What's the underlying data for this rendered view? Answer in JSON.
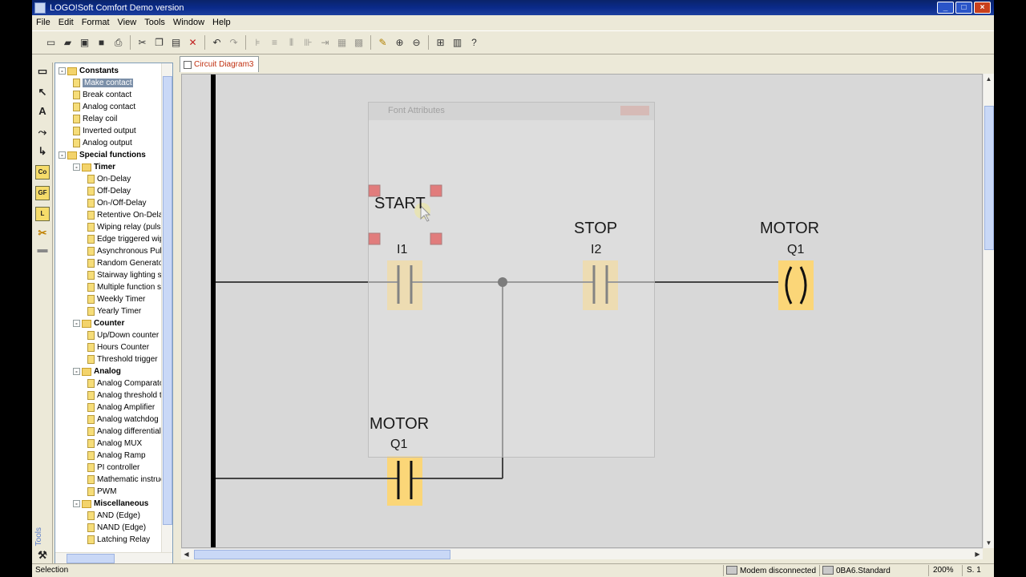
{
  "window": {
    "title": "LOGO!Soft Comfort Demo version",
    "buttons": {
      "minimize": "_",
      "maximize": "□",
      "close": "×"
    }
  },
  "menu": [
    "File",
    "Edit",
    "Format",
    "View",
    "Tools",
    "Window",
    "Help"
  ],
  "toolbar": {
    "icons": [
      "new-icon",
      "open-icon",
      "close-file-icon",
      "save-icon",
      "print-icon",
      "cut-icon",
      "copy-icon",
      "paste-icon",
      "delete-icon",
      "undo-icon",
      "redo-icon",
      "align-left-icon",
      "align-center-icon",
      "align-top-icon",
      "distribute-icon",
      "connect-icon",
      "block-icon",
      "block2-icon",
      "pencil-icon",
      "zoom-in-icon",
      "zoom-out-icon",
      "fit-icon",
      "help-book-icon",
      "whats-this-icon"
    ]
  },
  "toolstrip": {
    "items": [
      "pointer-tool-icon",
      "text-tool-icon",
      "connector-tool-icon",
      "split-connector-icon",
      "co-block-icon",
      "gf-block-icon",
      "sf-block-icon",
      "wire-cut-icon",
      "stamp-icon"
    ],
    "co_label": "Co",
    "gf_label": "GF",
    "sf_label": "L",
    "tools_label": "Tools"
  },
  "tree": {
    "items": [
      {
        "label": "Constants",
        "level": 0,
        "type": "group",
        "exp": "-"
      },
      {
        "label": "Make contact",
        "level": 1,
        "type": "leaf",
        "selected": true
      },
      {
        "label": "Break contact",
        "level": 1,
        "type": "leaf"
      },
      {
        "label": "Analog contact",
        "level": 1,
        "type": "leaf"
      },
      {
        "label": "Relay coil",
        "level": 1,
        "type": "leaf"
      },
      {
        "label": "Inverted output",
        "level": 1,
        "type": "leaf"
      },
      {
        "label": "Analog output",
        "level": 1,
        "type": "leaf"
      },
      {
        "label": "Special functions",
        "level": 0,
        "type": "group",
        "exp": "-"
      },
      {
        "label": "Timer",
        "level": 1,
        "type": "group",
        "exp": "-"
      },
      {
        "label": "On-Delay",
        "level": 2,
        "type": "leaf"
      },
      {
        "label": "Off-Delay",
        "level": 2,
        "type": "leaf"
      },
      {
        "label": "On-/Off-Delay",
        "level": 2,
        "type": "leaf"
      },
      {
        "label": "Retentive On-Dela",
        "level": 2,
        "type": "leaf"
      },
      {
        "label": "Wiping relay (pulse",
        "level": 2,
        "type": "leaf"
      },
      {
        "label": "Edge triggered wip",
        "level": 2,
        "type": "leaf"
      },
      {
        "label": "Asynchronous Puls",
        "level": 2,
        "type": "leaf"
      },
      {
        "label": "Random Generator",
        "level": 2,
        "type": "leaf"
      },
      {
        "label": "Stairway lighting s",
        "level": 2,
        "type": "leaf"
      },
      {
        "label": "Multiple function s",
        "level": 2,
        "type": "leaf"
      },
      {
        "label": "Weekly Timer",
        "level": 2,
        "type": "leaf"
      },
      {
        "label": "Yearly Timer",
        "level": 2,
        "type": "leaf"
      },
      {
        "label": "Counter",
        "level": 1,
        "type": "group",
        "exp": "-"
      },
      {
        "label": "Up/Down counter",
        "level": 2,
        "type": "leaf"
      },
      {
        "label": "Hours Counter",
        "level": 2,
        "type": "leaf"
      },
      {
        "label": "Threshold trigger",
        "level": 2,
        "type": "leaf"
      },
      {
        "label": "Analog",
        "level": 1,
        "type": "group",
        "exp": "-"
      },
      {
        "label": "Analog Comparato",
        "level": 2,
        "type": "leaf"
      },
      {
        "label": "Analog threshold t",
        "level": 2,
        "type": "leaf"
      },
      {
        "label": "Analog Amplifier",
        "level": 2,
        "type": "leaf"
      },
      {
        "label": "Analog watchdog",
        "level": 2,
        "type": "leaf"
      },
      {
        "label": "Analog differential",
        "level": 2,
        "type": "leaf"
      },
      {
        "label": "Analog MUX",
        "level": 2,
        "type": "leaf"
      },
      {
        "label": "Analog Ramp",
        "level": 2,
        "type": "leaf"
      },
      {
        "label": "PI controller",
        "level": 2,
        "type": "leaf"
      },
      {
        "label": "Mathematic instruc",
        "level": 2,
        "type": "leaf"
      },
      {
        "label": "PWM",
        "level": 2,
        "type": "leaf"
      },
      {
        "label": "Miscellaneous",
        "level": 1,
        "type": "group",
        "exp": "-"
      },
      {
        "label": "AND (Edge)",
        "level": 2,
        "type": "leaf"
      },
      {
        "label": "NAND (Edge)",
        "level": 2,
        "type": "leaf"
      },
      {
        "label": "Latching Relay",
        "level": 2,
        "type": "leaf"
      }
    ]
  },
  "tabs": [
    {
      "label": "Circuit Diagram3",
      "active": true
    }
  ],
  "diagram": {
    "start_label": "START",
    "i1_label": "I1",
    "stop_label": "STOP",
    "i2_label": "I2",
    "motor_label": "MOTOR",
    "q1_label": "Q1",
    "holding_motor_label": "MOTOR",
    "holding_q1_label": "Q1",
    "coil_glyph": "( )",
    "block_color": "#fbd678",
    "handle_color": "#e00000",
    "ghost_dialog_title": "Font Attributes"
  },
  "status": {
    "mode": "Selection",
    "connection": "Modem disconnected",
    "device": "0BA6.Standard",
    "zoom": "200%",
    "page": "S. 1"
  }
}
